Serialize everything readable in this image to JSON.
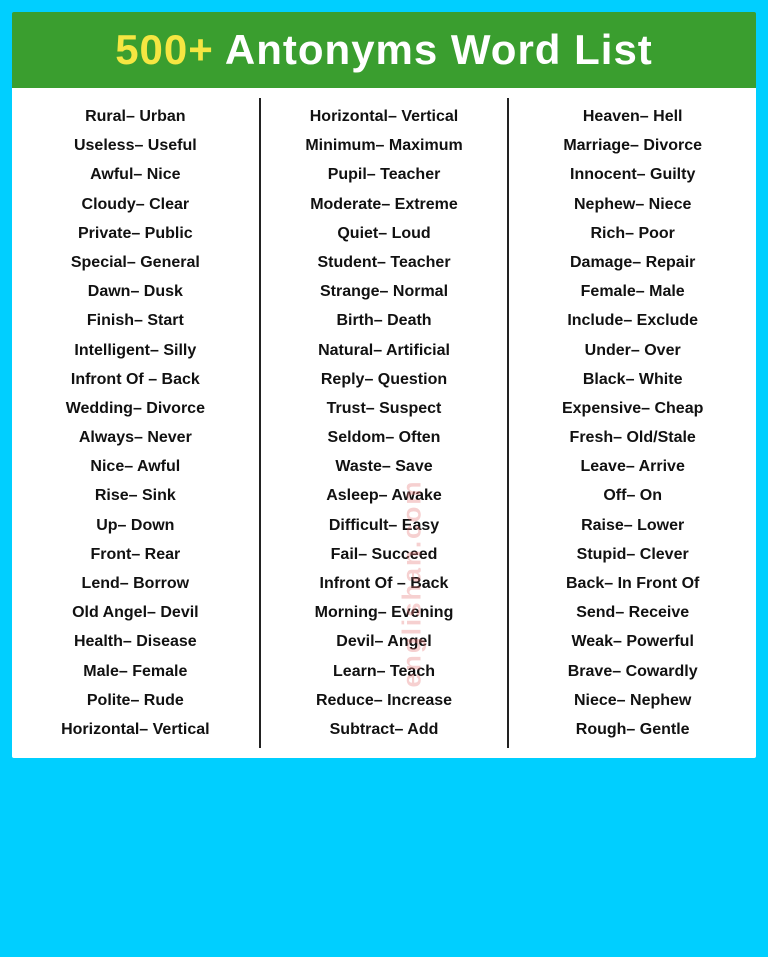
{
  "header": {
    "title_highlight": "500+",
    "title_rest": " Antonyms Word List"
  },
  "watermark": "englishan.com",
  "columns": [
    {
      "id": "col1",
      "pairs": [
        "Rural– Urban",
        "Useless– Useful",
        "Awful– Nice",
        "Cloudy– Clear",
        "Private– Public",
        "Special– General",
        "Dawn– Dusk",
        "Finish– Start",
        "Intelligent– Silly",
        "Infront Of – Back",
        "Wedding– Divorce",
        "Always– Never",
        "Nice– Awful",
        "Rise– Sink",
        "Up– Down",
        "Front– Rear",
        "Lend– Borrow",
        "Old Angel– Devil",
        "Health– Disease",
        "Male– Female",
        "Polite– Rude",
        "Horizontal– Vertical"
      ]
    },
    {
      "id": "col2",
      "pairs": [
        "Horizontal– Vertical",
        "Minimum– Maximum",
        "Pupil– Teacher",
        "Moderate– Extreme",
        "Quiet– Loud",
        "Student– Teacher",
        "Strange– Normal",
        "Birth– Death",
        "Natural– Artificial",
        "Reply– Question",
        "Trust– Suspect",
        "Seldom– Often",
        "Waste– Save",
        "Asleep– Awake",
        "Difficult– Easy",
        "Fail– Succeed",
        "Infront Of – Back",
        "Morning– Evening",
        "Devil– Angel",
        "Learn– Teach",
        "Reduce– Increase",
        "Subtract– Add"
      ]
    },
    {
      "id": "col3",
      "pairs": [
        "Heaven– Hell",
        "Marriage– Divorce",
        "Innocent– Guilty",
        "Nephew– Niece",
        "Rich– Poor",
        "Damage– Repair",
        "Female– Male",
        "Include– Exclude",
        "Under– Over",
        "Black– White",
        "Expensive– Cheap",
        "Fresh– Old/Stale",
        "Leave– Arrive",
        "Off– On",
        "Raise– Lower",
        "Stupid– Clever",
        "Back– In Front Of",
        "Send– Receive",
        "Weak– Powerful",
        "Brave– Cowardly",
        "Niece– Nephew",
        "Rough– Gentle"
      ]
    }
  ]
}
